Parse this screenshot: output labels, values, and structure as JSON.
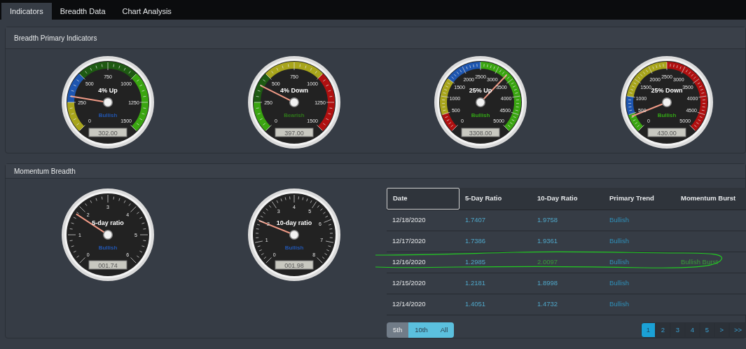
{
  "tabs": [
    {
      "label": "Indicators",
      "selected": true
    },
    {
      "label": "Breadth Data",
      "selected": false
    },
    {
      "label": "Chart Analysis",
      "selected": false
    }
  ],
  "panels": [
    {
      "title": "Breadth Primary Indicators",
      "gauges": [
        {
          "title": "4% Up",
          "ticks": [
            "0",
            "250",
            "500",
            "750",
            "1000",
            "1250",
            "1500"
          ],
          "status": "Bullish",
          "color": "#2256b0",
          "reading": "302.00",
          "level": 0.201,
          "bands": [
            {
              "color": "#a8a51c"
            },
            {
              "color": "#1e56b0"
            },
            {
              "color": "#1e5a12"
            },
            {
              "color": "#1e5a12"
            },
            {
              "color": "#3aa511"
            },
            {
              "color": "#3aa511"
            }
          ]
        },
        {
          "title": "4% Down",
          "ticks": [
            "0",
            "250",
            "500",
            "750",
            "1000",
            "1250",
            "1500"
          ],
          "status": "Bearish",
          "color": "#2f7a1a",
          "reading": "397.00",
          "level": 0.265,
          "bands": [
            {
              "color": "#3aa511"
            },
            {
              "color": "#1e5a12"
            },
            {
              "color": "#a8a51c"
            },
            {
              "color": "#a8a51c"
            },
            {
              "color": "#b01010"
            },
            {
              "color": "#b01010"
            }
          ]
        },
        {
          "title": "25% Up",
          "ticks": [
            "0",
            "500",
            "1000",
            "1500",
            "2000",
            "2500",
            "3000",
            "3500",
            "4000",
            "4500",
            "5000"
          ],
          "status": "Bullish",
          "color": "#34a816",
          "reading": "3308.00",
          "level": 0.662,
          "bands": [
            {
              "color": "#b01010"
            },
            {
              "color": "#a8a51c"
            },
            {
              "color": "#a8a51c"
            },
            {
              "color": "#1e56b0"
            },
            {
              "color": "#1e56b0"
            },
            {
              "color": "#3aa511"
            },
            {
              "color": "#3aa511"
            },
            {
              "color": "#3aa511"
            },
            {
              "color": "#3aa511"
            },
            {
              "color": "#3aa511"
            }
          ]
        },
        {
          "title": "25% Down",
          "ticks": [
            "0",
            "500",
            "1000",
            "1500",
            "2000",
            "2500",
            "3000",
            "3500",
            "4000",
            "4500",
            "5000"
          ],
          "status": "Bullish",
          "color": "#34a816",
          "reading": "430.00",
          "level": 0.086,
          "bands": [
            {
              "color": "#3aa511"
            },
            {
              "color": "#1e56b0"
            },
            {
              "color": "#a8a51c"
            },
            {
              "color": "#a8a51c"
            },
            {
              "color": "#a8a51c"
            },
            {
              "color": "#b01010"
            },
            {
              "color": "#b01010"
            },
            {
              "color": "#b01010"
            },
            {
              "color": "#b01010"
            },
            {
              "color": "#b01010"
            }
          ]
        }
      ]
    },
    {
      "title": "Momentum Breadth",
      "gauges": [
        {
          "title": "5-day ratio",
          "ticks": [
            "0",
            "1",
            "2",
            "3",
            "4",
            "5",
            "6"
          ],
          "status": "Bullish",
          "color": "#2256b0",
          "reading": "001.74",
          "level": 0.29
        },
        {
          "title": "10-day ratio",
          "ticks": [
            "0",
            "1",
            "2",
            "3",
            "4",
            "5",
            "6",
            "7",
            "8"
          ],
          "status": "Bullish",
          "color": "#2256b0",
          "reading": "001.98",
          "level": 0.2475
        }
      ],
      "table": {
        "columns": [
          {
            "label": "Date",
            "selected": true
          },
          {
            "label": "5-Day Ratio",
            "selected": false
          },
          {
            "label": "10-Day Ratio",
            "selected": false
          },
          {
            "label": "Primary Trend",
            "selected": false
          },
          {
            "label": "Momentum Burst",
            "selected": false
          }
        ],
        "rows": [
          {
            "date": "12/18/2020",
            "five_day": "1.7407",
            "ten_day": "1.9758",
            "trend": "Bullish",
            "burst": false,
            "circled": false
          },
          {
            "date": "12/17/2020",
            "five_day": "1.7386",
            "ten_day": "1.9361",
            "trend": "Bullish",
            "burst": false,
            "circled": false
          },
          {
            "date": "12/16/2020",
            "five_day": "1.2985",
            "ten_day": "2.0097",
            "trend": "Bullish",
            "burst": true,
            "burst_label": "Bullish Burst",
            "circled": true
          },
          {
            "date": "12/15/2020",
            "five_day": "1.2181",
            "ten_day": "1.8998",
            "trend": "Bullish",
            "burst": false,
            "circled": false
          },
          {
            "date": "12/14/2020",
            "five_day": "1.4051",
            "ten_day": "1.4732",
            "trend": "Bullish",
            "burst": false,
            "circled": false
          }
        ]
      },
      "filters": [
        {
          "label": "5th",
          "selected": true
        },
        {
          "label": "10th",
          "selected": false
        },
        {
          "label": "All",
          "selected": false
        }
      ],
      "pages": [
        {
          "label": "1",
          "selected": true
        },
        {
          "label": "2",
          "selected": false
        },
        {
          "label": "3",
          "selected": false
        },
        {
          "label": "4",
          "selected": false
        },
        {
          "label": "5",
          "selected": false
        },
        {
          "label": ">",
          "selected": false
        },
        {
          "label": ">>",
          "selected": false
        }
      ]
    }
  ]
}
